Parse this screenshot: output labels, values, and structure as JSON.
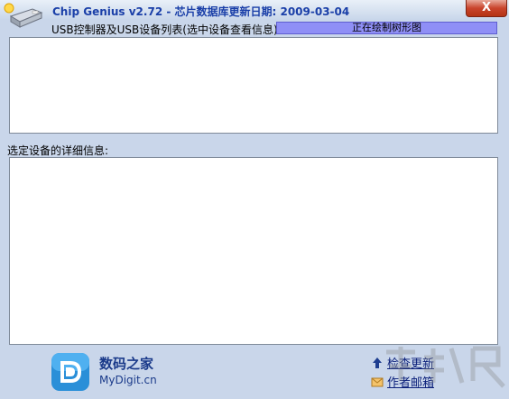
{
  "window": {
    "title": "Chip Genius v2.72 - 芯片数据库更新日期: 2009-03-04",
    "close_label": "X"
  },
  "device_list": {
    "label": "USB控制器及USB设备列表(选中设备查看信息):",
    "status": "正在绘制树形图"
  },
  "details": {
    "label": "选定设备的详细信息:"
  },
  "footer": {
    "brand_name": "数码之家",
    "brand_url": "MyDigit.cn",
    "check_update": "检查更新",
    "author_mail": "作者邮箱"
  },
  "colors": {
    "title_text": "#1a3fa8",
    "status_fill": "#8f8ff6",
    "close_button": "#c9442c",
    "window_bg": "#c9d6ea"
  }
}
